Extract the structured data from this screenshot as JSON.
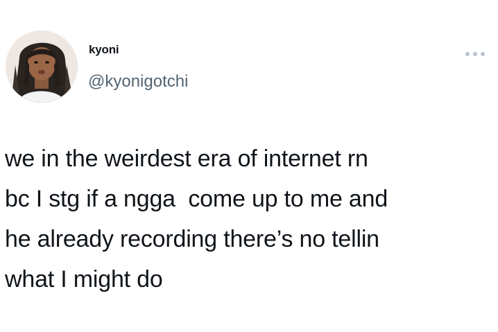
{
  "author": {
    "display_name": "kyoni",
    "handle": "@kyonigotchi",
    "avatar_icon": "profile-photo"
  },
  "more_icon": "ellipsis-icon",
  "tweet": {
    "lines": [
      "we in the weirdest era of internet rn",
      "bc I stg if a ngga  come up to me and",
      "he already recording there’s no tellin",
      "what I might do"
    ]
  },
  "colors": {
    "text": "#0f1419",
    "secondary": "#536471",
    "more_dots": "#b9c2cb",
    "background": "#ffffff"
  }
}
